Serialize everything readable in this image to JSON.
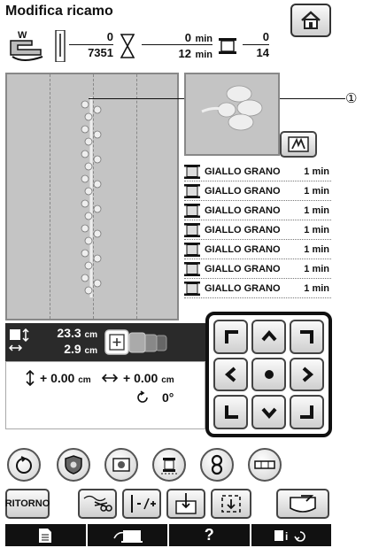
{
  "header": {
    "title": "Modifica ricamo"
  },
  "stats": {
    "stitch_current": "0",
    "stitch_total": "7351",
    "time_current": "0",
    "time_total": "12",
    "time_unit": "min",
    "color_current": "0",
    "color_total": "14"
  },
  "callout": {
    "label": "①"
  },
  "threads": [
    {
      "name": "GIALLO GRANO",
      "time": "1 min"
    },
    {
      "name": "GIALLO GRANO",
      "time": "1 min"
    },
    {
      "name": "GIALLO GRANO",
      "time": "1 min"
    },
    {
      "name": "GIALLO GRANO",
      "time": "1 min"
    },
    {
      "name": "GIALLO GRANO",
      "time": "1 min"
    },
    {
      "name": "GIALLO GRANO",
      "time": "1 min"
    },
    {
      "name": "GIALLO GRANO",
      "time": "1 min"
    }
  ],
  "size": {
    "height": "23.3",
    "width": "2.9",
    "unit": "cm"
  },
  "position": {
    "y_prefix": "+",
    "y": "0.00",
    "x_prefix": "+",
    "x": "0.00",
    "unit": "cm",
    "rotation": "0°"
  },
  "buttons": {
    "ritorno": "RITORNO"
  },
  "colors": {
    "canvas_bg": "#c4c4c4",
    "bottom_bar": "#111111",
    "size_bar": "#2a2a2a"
  }
}
